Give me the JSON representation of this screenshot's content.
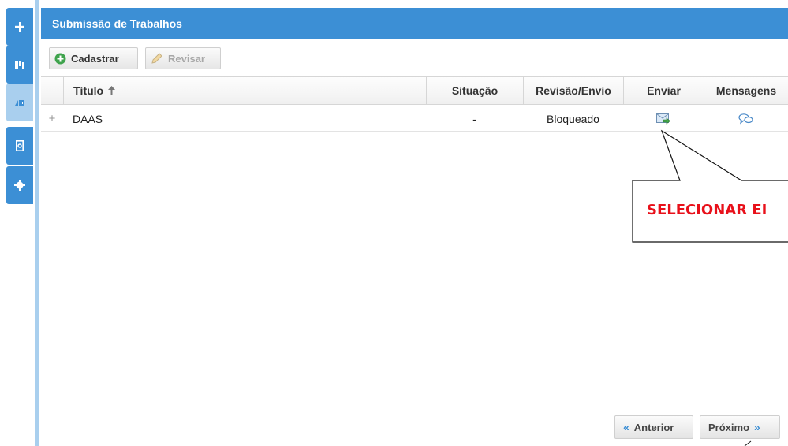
{
  "sidebar": {
    "buttons": [
      {
        "icon": "plus-icon"
      },
      {
        "icon": "map-icon"
      },
      {
        "icon": "sign-icon"
      },
      {
        "icon": "document-icon"
      },
      {
        "icon": "gear-icon"
      }
    ]
  },
  "header": {
    "title": "Submissão de Trabalhos"
  },
  "toolbar": {
    "add_label": "Cadastrar",
    "review_label": "Revisar"
  },
  "table": {
    "columns": {
      "title": "Título",
      "status": "Situação",
      "review": "Revisão/Envio",
      "send": "Enviar",
      "messages": "Mensagens"
    },
    "sort_indicator": "sort-ascending-icon",
    "rows": [
      {
        "expand": "+",
        "title": "DAAS",
        "status": "-",
        "review": "Bloqueado",
        "send_icon": "send-mail-icon",
        "messages_icon": "chat-bubbles-icon"
      }
    ]
  },
  "callout": {
    "text": "SELECIONAR EI"
  },
  "pager": {
    "prev_label": "Anterior",
    "next_label": "Próximo"
  },
  "colors": {
    "accent": "#3c8fd5",
    "accent_light": "#a9cfee",
    "callout_text": "#e8101a"
  }
}
